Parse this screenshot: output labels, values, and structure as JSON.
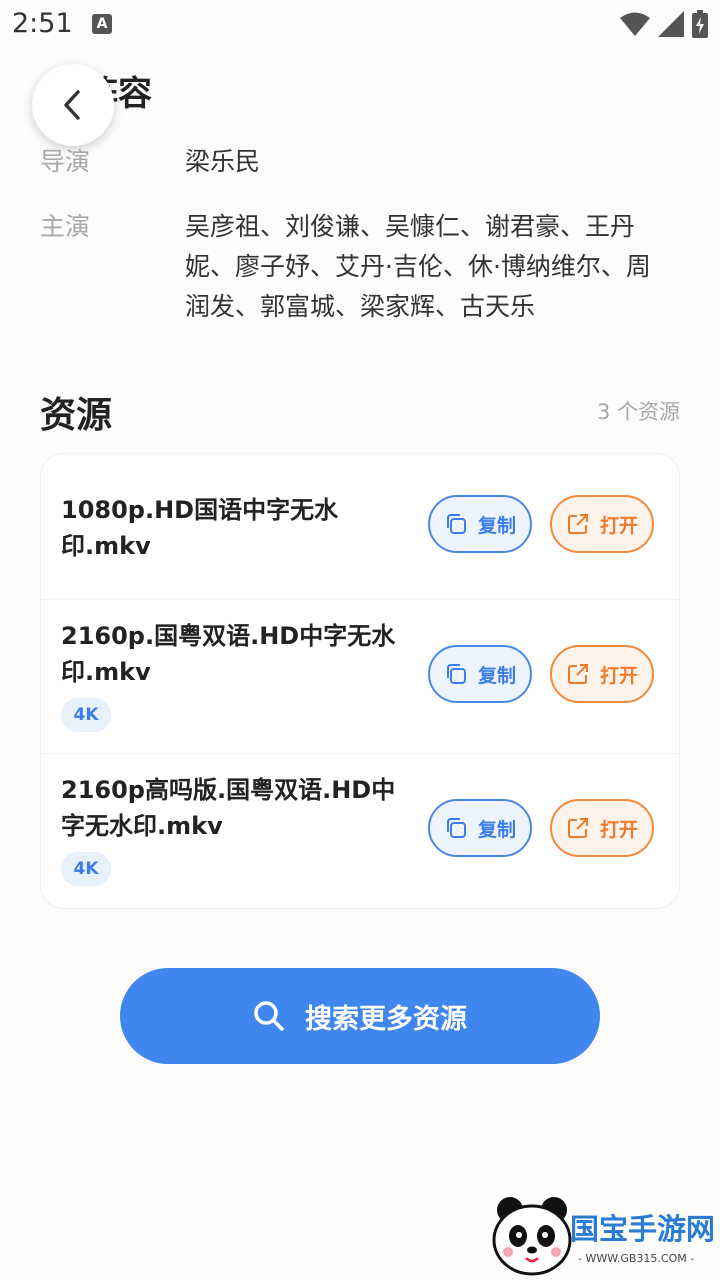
{
  "status_bar": {
    "time": "2:51",
    "notification_letter": "A"
  },
  "header": {
    "title_partial": "阵容"
  },
  "info": [
    {
      "label": "导演",
      "value": "梁乐民"
    },
    {
      "label": "主演",
      "value": "吴彦祖、刘俊谦、吴慷仁、谢君豪、王丹妮、廖子妤、艾丹·吉伦、休·博纳维尔、周润发、郭富城、梁家辉、古天乐"
    }
  ],
  "resources": {
    "title": "资源",
    "count_text": "3 个资源",
    "copy_label": "复制",
    "open_label": "打开",
    "items": [
      {
        "name": "1080p.HD国语中字无水印.mkv",
        "badge": ""
      },
      {
        "name": "2160p.国粤双语.HD中字无水印.mkv",
        "badge": "4K"
      },
      {
        "name": "2160p高吗版.国粤双语.HD中字无水印.mkv",
        "badge": "4K"
      }
    ]
  },
  "search_more": {
    "label": "搜索更多资源"
  },
  "watermark": {
    "text": "国宝手游网",
    "url": "- WWW.GB315.COM -"
  },
  "colors": {
    "primary": "#3f86ee",
    "open_accent": "#ee7a2c",
    "muted": "#a8a8a8"
  },
  "icons": [
    "back-arrow-icon",
    "copy-icon",
    "external-open-icon",
    "search-icon",
    "wifi-icon",
    "signal-icon",
    "battery-icon"
  ]
}
